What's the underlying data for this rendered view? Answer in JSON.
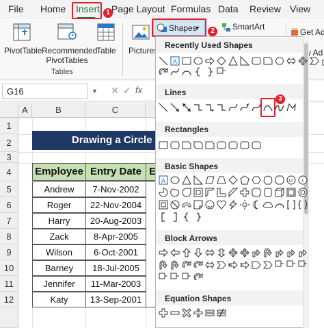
{
  "tabs": [
    "File",
    "Home",
    "Insert",
    "Page Layout",
    "Formulas",
    "Data",
    "Review",
    "View"
  ],
  "ribbon": {
    "pivottable": "PivotTable",
    "recommended_line1": "Recommended",
    "recommended_line2": "PivotTables",
    "table": "Table",
    "tables_group": "Tables",
    "pictures": "Pictures",
    "shapes": "Shapes",
    "smartart": "SmartArt",
    "get_addins": "Get Ad",
    "my_addins": "My Ad"
  },
  "formula_bar": {
    "name_box": "G16",
    "fx": "fx"
  },
  "columns": [
    "A",
    "B",
    "C"
  ],
  "rows": [
    "1",
    "2",
    "3",
    "4",
    "5",
    "6",
    "7",
    "8",
    "9",
    "10",
    "11",
    "12"
  ],
  "sheet": {
    "title": "Drawing a Circle",
    "headers": [
      "Employee",
      "Entry Date",
      "E"
    ],
    "records": [
      [
        "Andrew",
        "7-Nov-2002"
      ],
      [
        "Roger",
        "22-Nov-2004"
      ],
      [
        "Harry",
        "20-Aug-2003"
      ],
      [
        "Zack",
        "8-Apr-2005"
      ],
      [
        "Wilson",
        "6-Oct-2001"
      ],
      [
        "Barney",
        "18-Jul-2005"
      ],
      [
        "Jennifer",
        "11-Mar-2003"
      ],
      [
        "Katy",
        "13-Sep-2001"
      ]
    ]
  },
  "dropdown": {
    "sections": [
      "Recently Used Shapes",
      "Lines",
      "Rectangles",
      "Basic Shapes",
      "Block Arrows",
      "Equation Shapes"
    ]
  },
  "steps": [
    "1",
    "2",
    "3"
  ],
  "colors": {
    "accent_green": "#217346",
    "highlight_red": "#e0202a",
    "title_fill": "#203864",
    "header_fill": "#c6e0b4"
  }
}
